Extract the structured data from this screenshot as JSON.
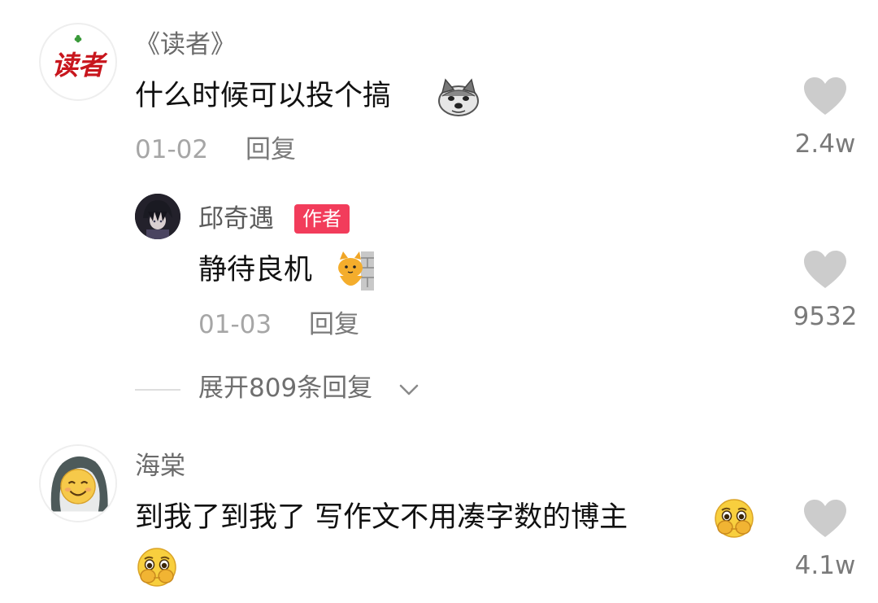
{
  "comments": [
    {
      "username": "《读者》",
      "avatar_text": "读者",
      "text": "什么时候可以投个搞",
      "emoji": "doge-dog-emoji",
      "date": "01-02",
      "reply_label": "回复",
      "likes": "2.4w",
      "replies": [
        {
          "username": "邱奇遇",
          "badge": "作者",
          "text": "静待良机",
          "emoji": "peeking-cat-emoji",
          "date": "01-03",
          "reply_label": "回复",
          "likes": "9532"
        }
      ],
      "expand_label": "展开809条回复"
    },
    {
      "username": "海棠",
      "text": "到我了到我了 写作文不用凑字数的博主",
      "emoji": "pleading-face-emoji",
      "likes": "4.1w"
    }
  ],
  "colors": {
    "badge": "#f23c5b",
    "heart": "#cccccc",
    "username": "#6b6b6b",
    "meta": "#a6a6a6"
  }
}
